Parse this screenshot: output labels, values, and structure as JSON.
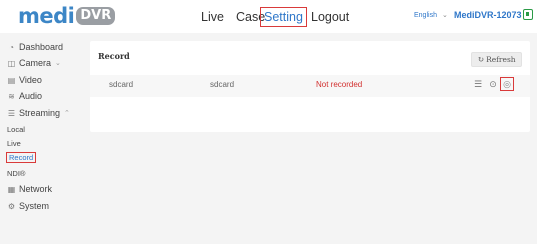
{
  "header": {
    "logo_main": "medi",
    "logo_badge": "DVR",
    "nav": {
      "live": "Live",
      "case": "Case",
      "setting": "Setting",
      "logout": "Logout"
    },
    "language": "English",
    "device_name": "MediDVR-12073"
  },
  "sidebar": {
    "dashboard": "Dashboard",
    "camera": "Camera",
    "video": "Video",
    "audio": "Audio",
    "streaming": "Streaming",
    "streaming_sub": {
      "local": "Local",
      "live": "Live",
      "record": "Record",
      "ndi": "NDI®"
    },
    "network": "Network",
    "system": "System"
  },
  "panel": {
    "title": "Record",
    "refresh_label": "Refresh",
    "rows": [
      {
        "source": "sdcard",
        "target": "sdcard",
        "status": "Not recorded"
      }
    ]
  },
  "colors": {
    "accent": "#2f77c9",
    "status_error": "#d2302f",
    "highlight_border": "#d93a3a"
  }
}
